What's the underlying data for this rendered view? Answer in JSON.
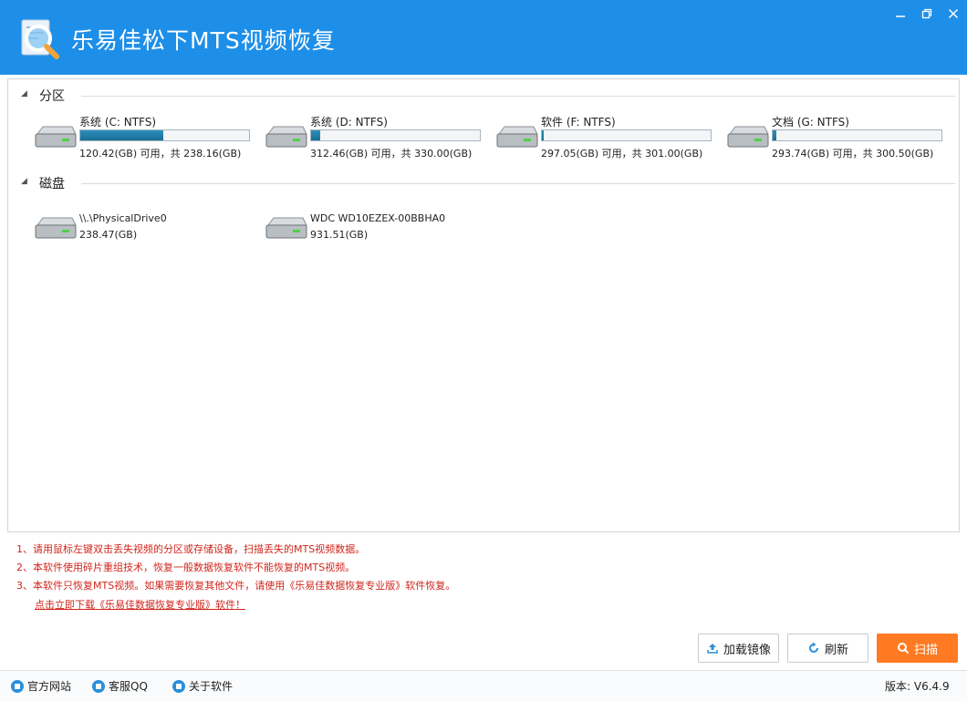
{
  "window": {
    "title": "乐易佳松下MTS视频恢复",
    "min_icon": "minimize-icon",
    "max_icon": "restore-icon",
    "close_icon": "close-icon",
    "accent": "#1e8fe8"
  },
  "sections": {
    "partitions_label": "分区",
    "disks_label": "磁盘"
  },
  "partitions": [
    {
      "name": "系统 (C: NTFS)",
      "info": "120.42(GB) 可用，共 238.16(GB)",
      "used_fraction": 0.494
    },
    {
      "name": "系统 (D: NTFS)",
      "info": "312.46(GB) 可用，共 330.00(GB)",
      "used_fraction": 0.053
    },
    {
      "name": "软件 (F: NTFS)",
      "info": "297.05(GB) 可用，共 301.00(GB)",
      "used_fraction": 0.013
    },
    {
      "name": "文档 (G: NTFS)",
      "info": "293.74(GB) 可用，共 300.50(GB)",
      "used_fraction": 0.022
    }
  ],
  "disks": [
    {
      "name": "\\\\.\\PhysicalDrive0",
      "size": "238.47(GB)"
    },
    {
      "name": "WDC WD10EZEX-00BBHA0",
      "size": "931.51(GB)"
    }
  ],
  "tips": {
    "line1": "1、请用鼠标左键双击丢失视频的分区或存储设备，扫描丢失的MTS视频数据。",
    "line2": "2、本软件使用碎片重组技术，恢复一般数据恢复软件不能恢复的MTS视频。",
    "line3": "3、本软件只恢复MTS视频。如果需要恢复其他文件，请使用《乐易佳数据恢复专业版》软件恢复。",
    "link": "点击立即下载《乐易佳数据恢复专业版》软件！",
    "color": "#d0261c"
  },
  "buttons": {
    "mount": "加载镜像",
    "refresh": "刷新",
    "scan": "扫描",
    "scan_color": "#ff7a22"
  },
  "statusbar": {
    "website": "官方网站",
    "qq": "客服QQ",
    "about": "关于软件",
    "version": "版本: V6.4.9"
  }
}
